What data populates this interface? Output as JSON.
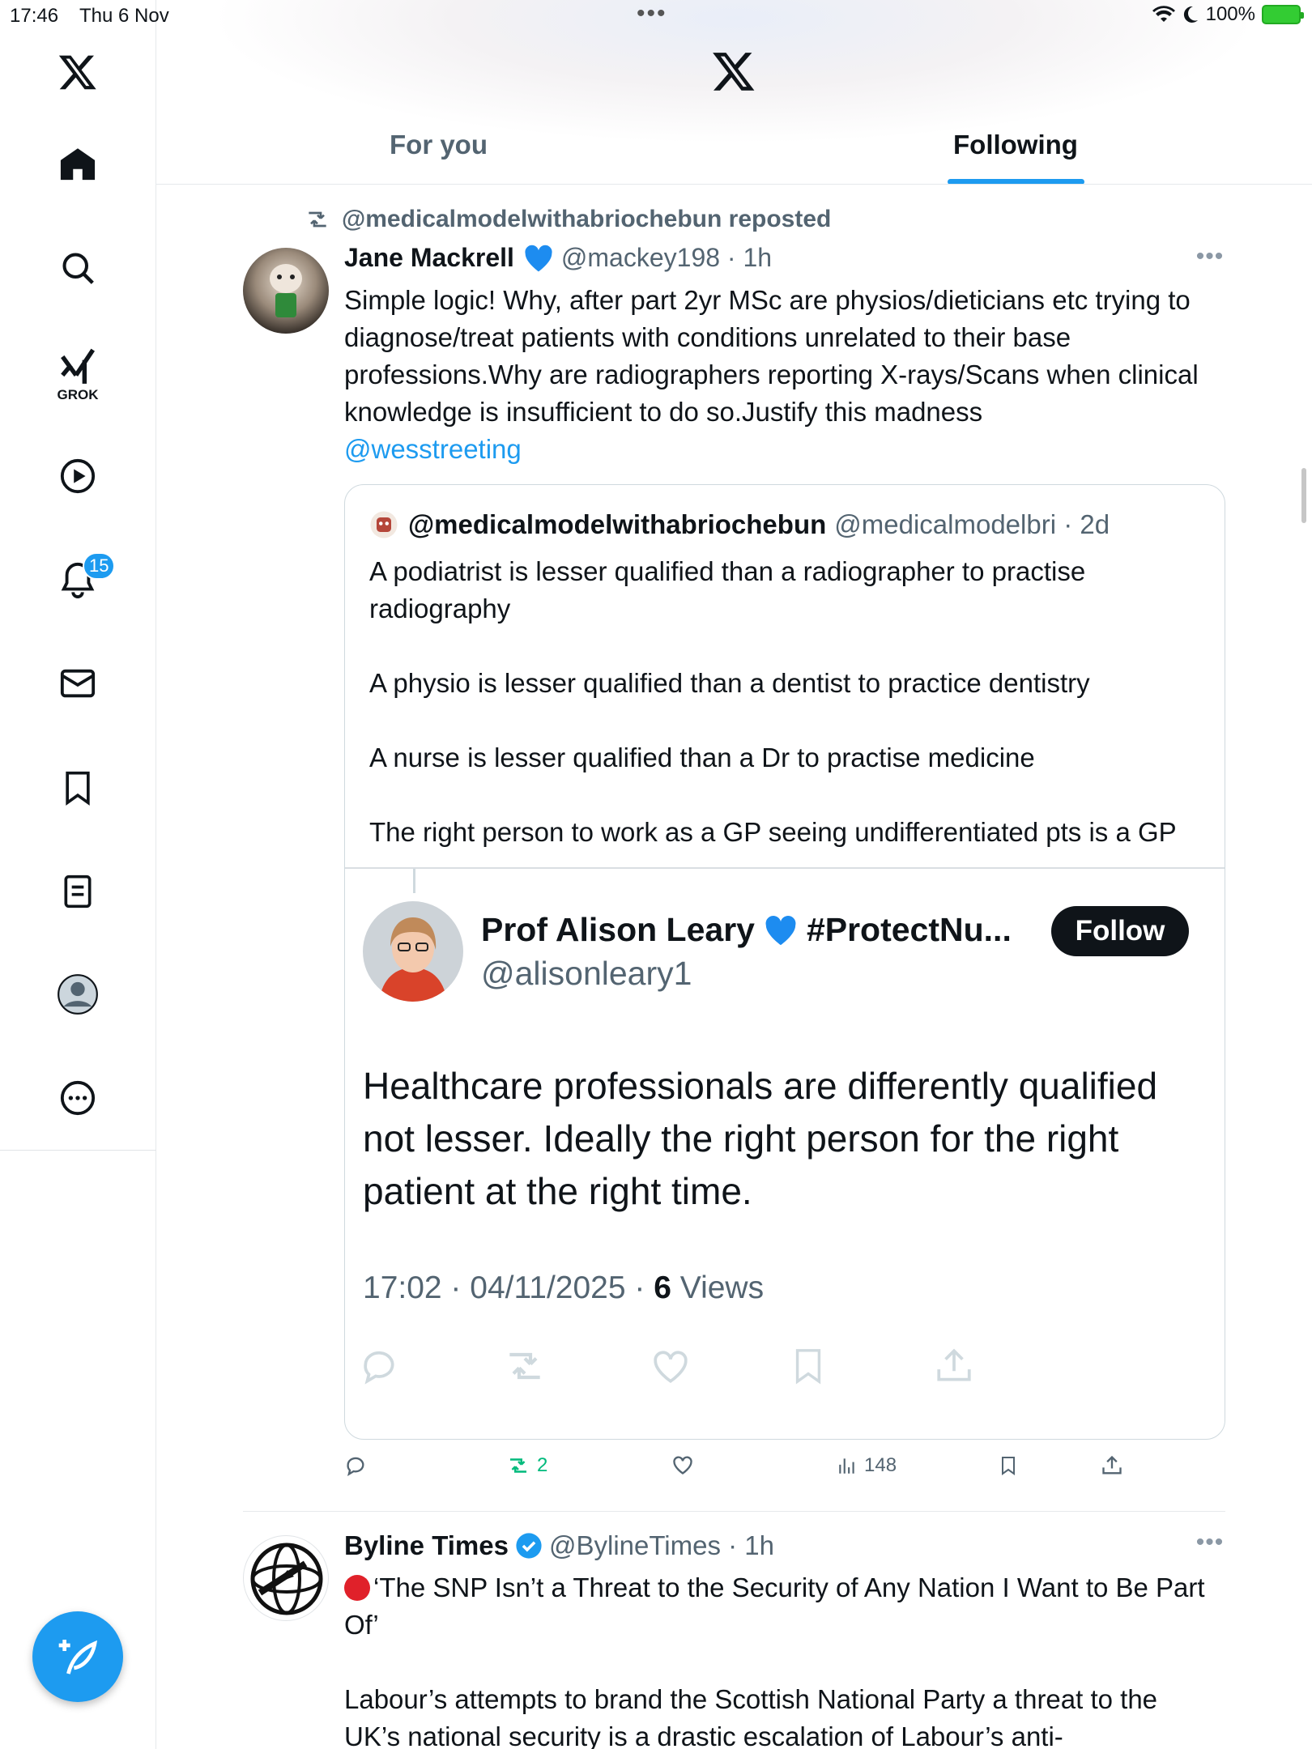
{
  "status_bar": {
    "time": "17:46",
    "date": "Thu 6 Nov",
    "battery": "100%"
  },
  "tabs": [
    {
      "label": "For you",
      "active": false
    },
    {
      "label": "Following",
      "active": true
    }
  ],
  "sidebar": {
    "notifications_badge": "15",
    "grok_label": "GROK"
  },
  "post1": {
    "repost_label": "@medicalmodelwithabriochebun reposted",
    "author_name": "Jane Mackrell",
    "handle_time": "@mackey198 · 1h",
    "text": "Simple logic! Why, after part 2yr MSc are physios/dieticians etc trying to diagnose/treat patients with conditions unrelated to their base professions.Why are radiographers reporting X-rays/Scans when clinical knowledge is insufficient to do so.Justify this madness",
    "mention": "@wesstreeting",
    "quote": {
      "author_name": "@medicalmodelwithabriochebun",
      "handle_time": "@medicalmodelbri · 2d",
      "paragraphs": [
        "A podiatrist is lesser qualified than a radiographer to practise radiography",
        "A physio is lesser qualified than a dentist to practice dentistry",
        "A nurse is lesser qualified than a Dr to practise medicine",
        "The right person to work as a GP seeing undifferentiated pts is a GP"
      ],
      "embedded": {
        "name_a": "Prof Alison Leary",
        "name_b": "#ProtectNu...",
        "handle": "@alisonleary1",
        "follow_label": "Follow",
        "text": "Healthcare professionals are differently qualified not lesser.  Ideally the right person for the right patient at the right time.",
        "meta_time": "17:02 · 04/11/2025 · ",
        "meta_views_count": "6",
        "meta_views_label": " Views"
      }
    },
    "actions": {
      "reposts": "2",
      "views": "148"
    }
  },
  "post2": {
    "author_name": "Byline Times",
    "handle_time": "@BylineTimes · 1h",
    "headline": "‘The SNP Isn’t a Threat to the Security of Any Nation I Want to Be Part Of’",
    "text": "Labour’s attempts to brand the Scottish National Party a threat to the UK’s national security is a drastic escalation of Labour’s anti-"
  },
  "colors": {
    "accent": "#1d9bf0",
    "text": "#0f1419",
    "secondary": "#536471",
    "repost_green": "#00ba7c"
  }
}
